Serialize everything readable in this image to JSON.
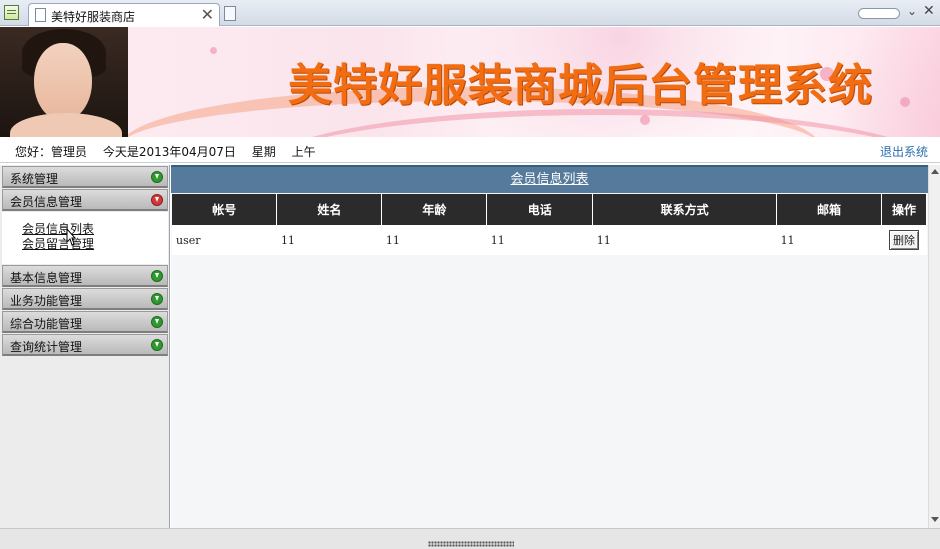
{
  "browser": {
    "tab_title": "美特好服装商店",
    "close_glyph": "✕",
    "menu_glyph": "⌄",
    "window_close_glyph": "✕"
  },
  "banner": {
    "title": "美特好服装商城后台管理系统"
  },
  "infobar": {
    "greeting": "您好：管理员",
    "date": "今天是2013年04月07日",
    "weekday": "星期",
    "period": "上午",
    "logout": "退出系统"
  },
  "sidebar": {
    "sections": [
      {
        "label": "系统管理",
        "expanded": false
      },
      {
        "label": "会员信息管理",
        "expanded": true,
        "items": [
          "会员信息列表",
          "会员留言管理"
        ]
      },
      {
        "label": "基本信息管理",
        "expanded": false
      },
      {
        "label": "业务功能管理",
        "expanded": false
      },
      {
        "label": "综合功能管理",
        "expanded": false
      },
      {
        "label": "查询统计管理",
        "expanded": false
      }
    ]
  },
  "main": {
    "title": "会员信息列表",
    "columns": [
      "帐号",
      "姓名",
      "年龄",
      "电话",
      "联系方式",
      "邮箱",
      "操作"
    ],
    "rows": [
      {
        "account": "user",
        "name": "11",
        "age": "11",
        "phone": "11",
        "contact": "11",
        "email": "11",
        "action": "删除"
      }
    ]
  },
  "colors": {
    "banner_title": "#f26d12",
    "header_bar": "#567a9b",
    "table_header": "#2b2b2b",
    "logout_link": "#2a6fb0"
  }
}
